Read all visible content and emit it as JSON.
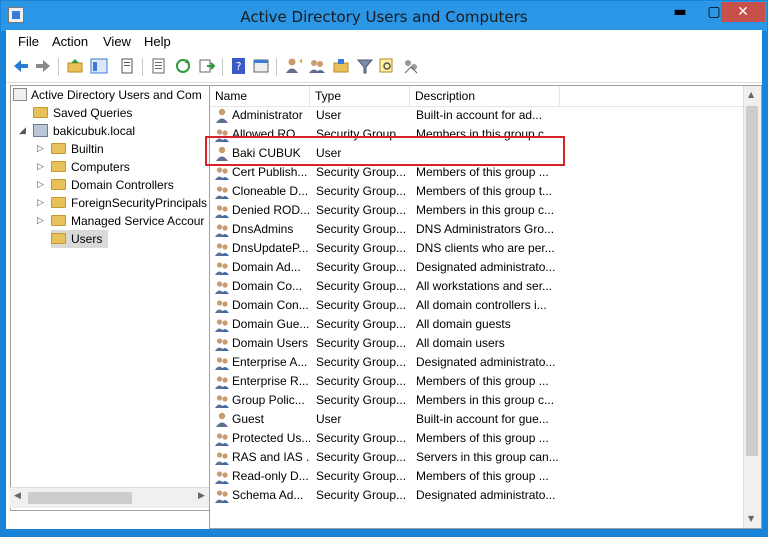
{
  "window": {
    "title": "Active Directory Users and Computers",
    "min_icon": "minimize-icon",
    "max_icon": "maximize-icon",
    "close_icon": "close-icon",
    "min_glyph": "▬",
    "max_glyph": "▢",
    "close_glyph": "✕"
  },
  "menu": [
    "File",
    "Action",
    "View",
    "Help"
  ],
  "toolbar": {
    "icons": [
      "back-arrow-icon",
      "forward-arrow-icon",
      "up-folder-icon",
      "show-console-tree-icon",
      "properties-icon",
      "export-list-icon",
      "refresh-icon",
      "export-icon",
      "help-icon",
      "console-icon",
      "new-user-icon",
      "new-group-icon",
      "new-ou-icon",
      "filter-icon",
      "find-icon",
      "add-to-group-icon"
    ]
  },
  "tree": {
    "root": "Active Directory Users and Com",
    "saved_queries": "Saved Queries",
    "domain": "bakicubuk.local",
    "children": [
      "Builtin",
      "Computers",
      "Domain Controllers",
      "ForeignSecurityPrincipals",
      "Managed Service Accour",
      "Users"
    ]
  },
  "list": {
    "columns": [
      "Name",
      "Type",
      "Description"
    ],
    "rows": [
      {
        "name": "Administrator",
        "type": "User",
        "desc": "Built-in account for ad...",
        "kind": "user"
      },
      {
        "name": "Allowed RO...",
        "type": "Security Group...",
        "desc": "Members in this group c...",
        "kind": "group"
      },
      {
        "name": "Baki CUBUK",
        "type": "User",
        "desc": "",
        "kind": "user"
      },
      {
        "name": "Cert Publish...",
        "type": "Security Group...",
        "desc": "Members of this group ...",
        "kind": "group"
      },
      {
        "name": "Cloneable D...",
        "type": "Security Group...",
        "desc": "Members of this group t...",
        "kind": "group"
      },
      {
        "name": "Denied ROD...",
        "type": "Security Group...",
        "desc": "Members in this group c...",
        "kind": "group"
      },
      {
        "name": "DnsAdmins",
        "type": "Security Group...",
        "desc": "DNS Administrators Gro...",
        "kind": "group"
      },
      {
        "name": "DnsUpdateP...",
        "type": "Security Group...",
        "desc": "DNS clients who are per...",
        "kind": "group"
      },
      {
        "name": "Domain Ad...",
        "type": "Security Group...",
        "desc": "Designated administrato...",
        "kind": "group"
      },
      {
        "name": "Domain Co...",
        "type": "Security Group...",
        "desc": "All workstations and ser...",
        "kind": "group"
      },
      {
        "name": "Domain Con...",
        "type": "Security Group...",
        "desc": "All domain controllers i...",
        "kind": "group"
      },
      {
        "name": "Domain Gue...",
        "type": "Security Group...",
        "desc": "All domain guests",
        "kind": "group"
      },
      {
        "name": "Domain Users",
        "type": "Security Group...",
        "desc": "All domain users",
        "kind": "group"
      },
      {
        "name": "Enterprise A...",
        "type": "Security Group...",
        "desc": "Designated administrato...",
        "kind": "group"
      },
      {
        "name": "Enterprise R...",
        "type": "Security Group...",
        "desc": "Members of this group ...",
        "kind": "group"
      },
      {
        "name": "Group Polic...",
        "type": "Security Group...",
        "desc": "Members in this group c...",
        "kind": "group"
      },
      {
        "name": "Guest",
        "type": "User",
        "desc": "Built-in account for gue...",
        "kind": "user"
      },
      {
        "name": "Protected Us...",
        "type": "Security Group...",
        "desc": "Members of this group ...",
        "kind": "group"
      },
      {
        "name": "RAS and IAS ...",
        "type": "Security Group...",
        "desc": "Servers in this group can...",
        "kind": "group"
      },
      {
        "name": "Read-only D...",
        "type": "Security Group...",
        "desc": "Members of this group ...",
        "kind": "group"
      },
      {
        "name": "Schema Ad...",
        "type": "Security Group...",
        "desc": "Designated administrato...",
        "kind": "group"
      }
    ]
  },
  "colors": {
    "titlebar": "#2b95e6",
    "highlight": "#d6242a",
    "close": "#c7504b"
  }
}
